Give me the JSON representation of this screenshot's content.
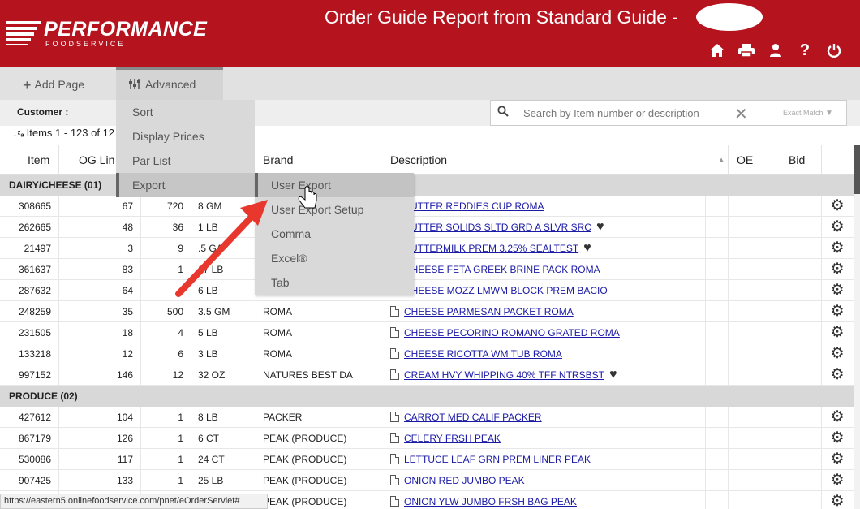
{
  "header": {
    "logo_text": "PERFORMANCE",
    "logo_sub": "FOODSERVICE",
    "title": "Order Guide Report from Standard Guide -",
    "icons": [
      "home-icon",
      "print-icon",
      "user-icon",
      "help-icon",
      "power-icon"
    ],
    "brand_color": "#b5141f"
  },
  "toolbar": {
    "add_page_label": "Add Page",
    "advanced_label": "Advanced"
  },
  "customer_label": "Customer :",
  "search": {
    "placeholder": "Search by Item number or description",
    "exact_match_label": "Exact Match"
  },
  "items_summary": "Items 1 - 123 of 12",
  "columns": [
    "Item",
    "OG Lin",
    "Brand",
    "Description",
    "OE",
    "Bid"
  ],
  "advanced_menu": [
    "Sort",
    "Display Prices",
    "Par List",
    "Export"
  ],
  "export_menu": [
    "User Export",
    "User Export Setup",
    "Comma",
    "Excel®",
    "Tab"
  ],
  "groups": [
    {
      "name": "DAIRY/CHEESE (01)",
      "rows": [
        {
          "item": "308665",
          "og_line": "67",
          "qty": "720",
          "pack": "8 GM",
          "brand": "",
          "desc": "BUTTER REDDIES CUP ROMA",
          "heart": false
        },
        {
          "item": "262665",
          "og_line": "48",
          "qty": "36",
          "pack": "1 LB",
          "brand": "",
          "desc": "BUTTER SOLIDS SLTD GRD A SLVR SRC",
          "heart": true
        },
        {
          "item": "21497",
          "og_line": "3",
          "qty": "9",
          "pack": ".5 GA",
          "brand": "",
          "desc": "BUTTERMILK PREM 3.25% SEALTEST",
          "heart": true
        },
        {
          "item": "361637",
          "og_line": "83",
          "qty": "1",
          "pack": "17 LB",
          "brand": "",
          "desc": "CHEESE FETA GREEK BRINE PACK ROMA",
          "heart": false
        },
        {
          "item": "287632",
          "og_line": "64",
          "qty": "",
          "pack": "6 LB",
          "brand": "",
          "desc": "CHEESE MOZZ LMWM BLOCK PREM BACIO",
          "heart": false
        },
        {
          "item": "248259",
          "og_line": "35",
          "qty": "500",
          "pack": "3.5 GM",
          "brand": "ROMA",
          "desc": "CHEESE PARMESAN PACKET ROMA",
          "heart": false
        },
        {
          "item": "231505",
          "og_line": "18",
          "qty": "4",
          "pack": "5 LB",
          "brand": "ROMA",
          "desc": "CHEESE PECORINO ROMANO GRATED ROMA",
          "heart": false
        },
        {
          "item": "133218",
          "og_line": "12",
          "qty": "6",
          "pack": "3 LB",
          "brand": "ROMA",
          "desc": "CHEESE RICOTTA WM TUB ROMA",
          "heart": false
        },
        {
          "item": "997152",
          "og_line": "146",
          "qty": "12",
          "pack": "32 OZ",
          "brand": "NATURES BEST DA",
          "desc": "CREAM HVY WHIPPING 40% TFF NTRSBST",
          "heart": true
        }
      ]
    },
    {
      "name": "PRODUCE (02)",
      "rows": [
        {
          "item": "427612",
          "og_line": "104",
          "qty": "1",
          "pack": "8 LB",
          "brand": "PACKER",
          "desc": "CARROT MED CALIF PACKER",
          "heart": false
        },
        {
          "item": "867179",
          "og_line": "126",
          "qty": "1",
          "pack": "6 CT",
          "brand": "PEAK (PRODUCE)",
          "desc": "CELERY FRSH PEAK",
          "heart": false
        },
        {
          "item": "530086",
          "og_line": "117",
          "qty": "1",
          "pack": "24 CT",
          "brand": "PEAK (PRODUCE)",
          "desc": "LETTUCE LEAF GRN PREM LINER PEAK",
          "heart": false
        },
        {
          "item": "907425",
          "og_line": "133",
          "qty": "1",
          "pack": "25 LB",
          "brand": "PEAK (PRODUCE)",
          "desc": "ONION RED JUMBO PEAK",
          "heart": false
        },
        {
          "item": "",
          "og_line": "",
          "qty": "",
          "pack": "",
          "brand": "PEAK (PRODUCE)",
          "desc": "ONION YLW JUMBO FRSH BAG PEAK",
          "heart": false
        }
      ]
    }
  ],
  "status_url": "https://eastern5.onlinefoodservice.com/pnet/eOrderServlet#"
}
